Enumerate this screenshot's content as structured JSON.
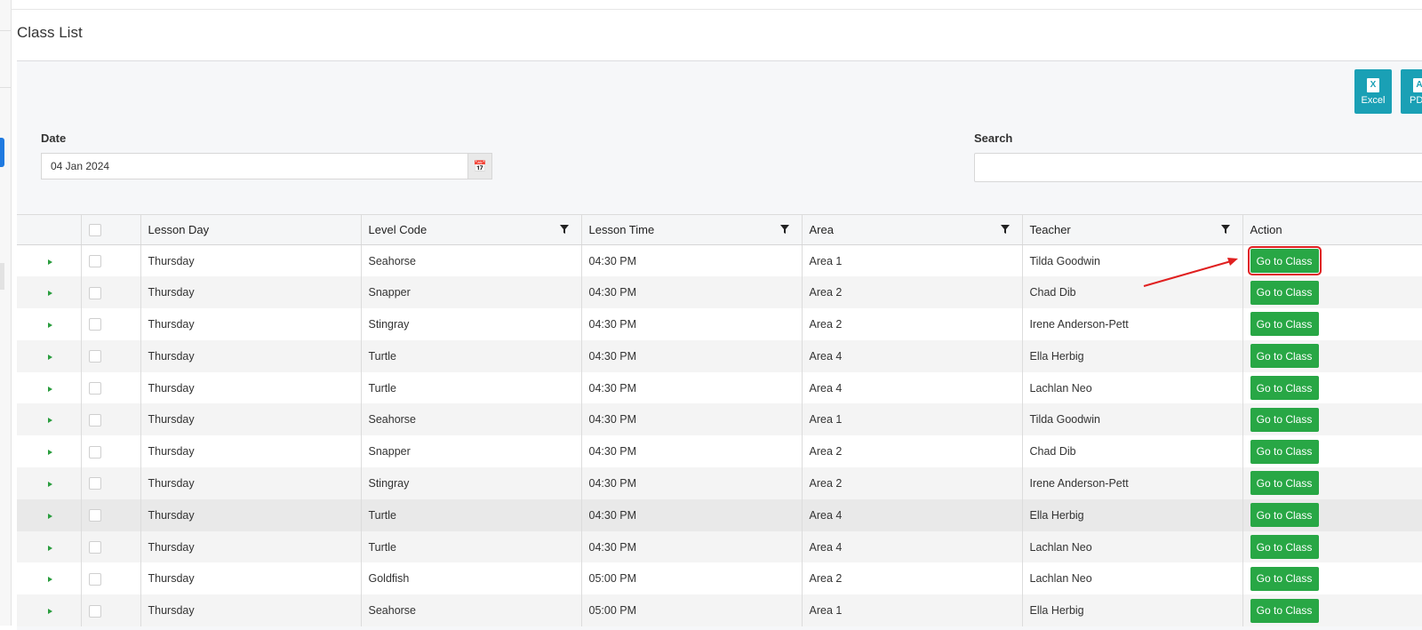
{
  "page": {
    "title": "Class List"
  },
  "exports": [
    {
      "label": "Excel",
      "icon": "excel-icon",
      "glyph": "X"
    },
    {
      "label": "PDF",
      "icon": "pdf-icon",
      "glyph": "A"
    }
  ],
  "filters": {
    "date_label": "Date",
    "date_value": "04 Jan 2024",
    "search_label": "Search",
    "search_value": ""
  },
  "table": {
    "columns": {
      "lesson_day": "Lesson Day",
      "level_code": "Level Code",
      "lesson_time": "Lesson Time",
      "area": "Area",
      "teacher": "Teacher",
      "action": "Action"
    },
    "rows": [
      {
        "day": "Thursday",
        "level": "Seahorse",
        "time": "04:30 PM",
        "area": "Area 1",
        "teacher": "Tilda Goodwin",
        "action": "Go to Class"
      },
      {
        "day": "Thursday",
        "level": "Snapper",
        "time": "04:30 PM",
        "area": "Area 2",
        "teacher": "Chad Dib",
        "action": "Go to Class"
      },
      {
        "day": "Thursday",
        "level": "Stingray",
        "time": "04:30 PM",
        "area": "Area 2",
        "teacher": "Irene Anderson-Pett",
        "action": "Go to Class"
      },
      {
        "day": "Thursday",
        "level": "Turtle",
        "time": "04:30 PM",
        "area": "Area 4",
        "teacher": "Ella Herbig",
        "action": "Go to Class"
      },
      {
        "day": "Thursday",
        "level": "Turtle",
        "time": "04:30 PM",
        "area": "Area 4",
        "teacher": "Lachlan Neo",
        "action": "Go to Class"
      },
      {
        "day": "Thursday",
        "level": "Seahorse",
        "time": "04:30 PM",
        "area": "Area 1",
        "teacher": "Tilda Goodwin",
        "action": "Go to Class"
      },
      {
        "day": "Thursday",
        "level": "Snapper",
        "time": "04:30 PM",
        "area": "Area 2",
        "teacher": "Chad Dib",
        "action": "Go to Class"
      },
      {
        "day": "Thursday",
        "level": "Stingray",
        "time": "04:30 PM",
        "area": "Area 2",
        "teacher": "Irene Anderson-Pett",
        "action": "Go to Class"
      },
      {
        "day": "Thursday",
        "level": "Turtle",
        "time": "04:30 PM",
        "area": "Area 4",
        "teacher": "Ella Herbig",
        "action": "Go to Class"
      },
      {
        "day": "Thursday",
        "level": "Turtle",
        "time": "04:30 PM",
        "area": "Area 4",
        "teacher": "Lachlan Neo",
        "action": "Go to Class"
      },
      {
        "day": "Thursday",
        "level": "Goldfish",
        "time": "05:00 PM",
        "area": "Area 2",
        "teacher": "Lachlan Neo",
        "action": "Go to Class"
      },
      {
        "day": "Thursday",
        "level": "Seahorse",
        "time": "05:00 PM",
        "area": "Area 1",
        "teacher": "Ella Herbig",
        "action": "Go to Class"
      }
    ]
  },
  "colors": {
    "accent_button": "#28a745",
    "export_button": "#1aa0b5",
    "annotation": "#e02020",
    "sidebar_active": "#1f7ae0"
  }
}
